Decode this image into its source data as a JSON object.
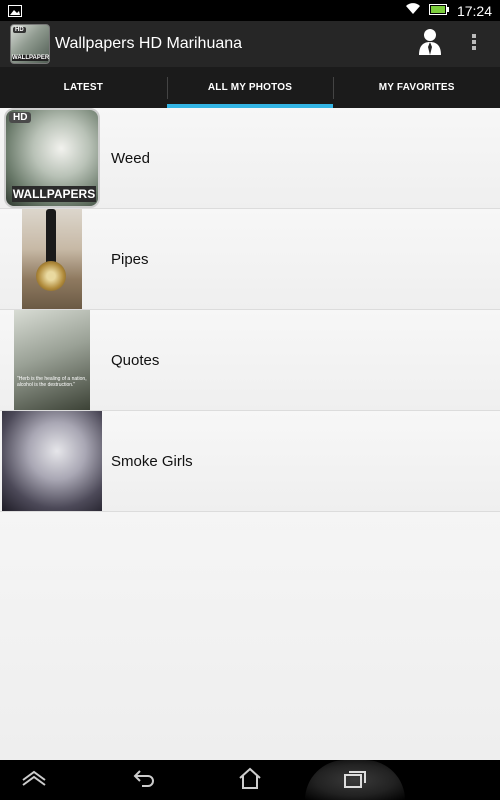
{
  "status_bar": {
    "time": "17:24"
  },
  "action_bar": {
    "app_icon_hd": "HD",
    "app_icon_wallpapers": "WALLPAPERS",
    "title": "Wallpapers HD Marihuana"
  },
  "tabs": [
    {
      "label": "LATEST"
    },
    {
      "label": "ALL MY PHOTOS"
    },
    {
      "label": "MY FAVORITES"
    }
  ],
  "list": {
    "items": [
      {
        "label": "Weed",
        "thumb_hd": "HD",
        "thumb_wallpapers": "WALLPAPERS"
      },
      {
        "label": "Pipes"
      },
      {
        "label": "Quotes",
        "thumb_text": "\"Herb is the healing of a nation, alcohol is the destruction.\""
      },
      {
        "label": "Smoke Girls"
      }
    ]
  },
  "colors": {
    "accent": "#33b5e5",
    "action_bar": "#262626",
    "tab_bar": "#1b1b1b"
  }
}
